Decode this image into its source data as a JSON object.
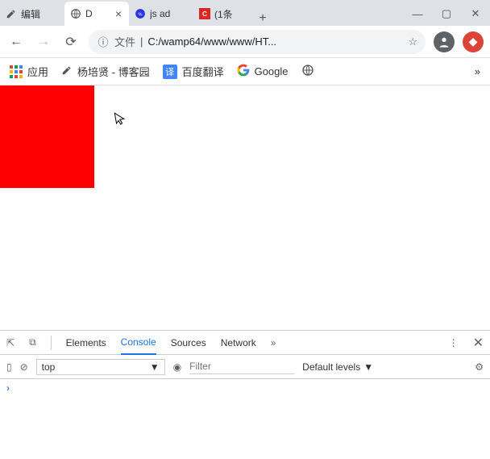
{
  "tabs": {
    "inactive1_label": "编辑",
    "active_label": "D",
    "inactive2_label": "js ad",
    "inactive3_label": "(1条",
    "new_tab": "+"
  },
  "window_controls": {
    "minimize": "—",
    "maximize": "▢",
    "close": "✕"
  },
  "nav": {
    "back": "←",
    "forward": "→",
    "reload": "⟳"
  },
  "omnibox": {
    "info_glyph": "ⓘ",
    "prefix": "文件",
    "sep": "|",
    "url": "C:/wamp64/www/www/HT...",
    "star": "☆"
  },
  "bookmarks": {
    "apps_label": "应用",
    "bm1_label": "杨培贤 - 博客园",
    "bm2_icon": "译",
    "bm2_label": "百度翻译",
    "bm3_label": "Google",
    "overflow": "»"
  },
  "devtools": {
    "tabs": {
      "elements": "Elements",
      "console": "Console",
      "sources": "Sources",
      "network": "Network"
    },
    "more": "»",
    "menu": "⋮",
    "close": "✕",
    "toolbar": {
      "side_icon": "▯",
      "clear_icon": "⊘",
      "context_value": "top",
      "context_arrow": "▼",
      "eye": "◉",
      "filter_placeholder": "Filter",
      "levels_label": "Default levels",
      "levels_arrow": "▼",
      "settings": "⚙"
    },
    "prompt": "›",
    "inspect_icon": "⇱",
    "device_icon": "⧉"
  }
}
